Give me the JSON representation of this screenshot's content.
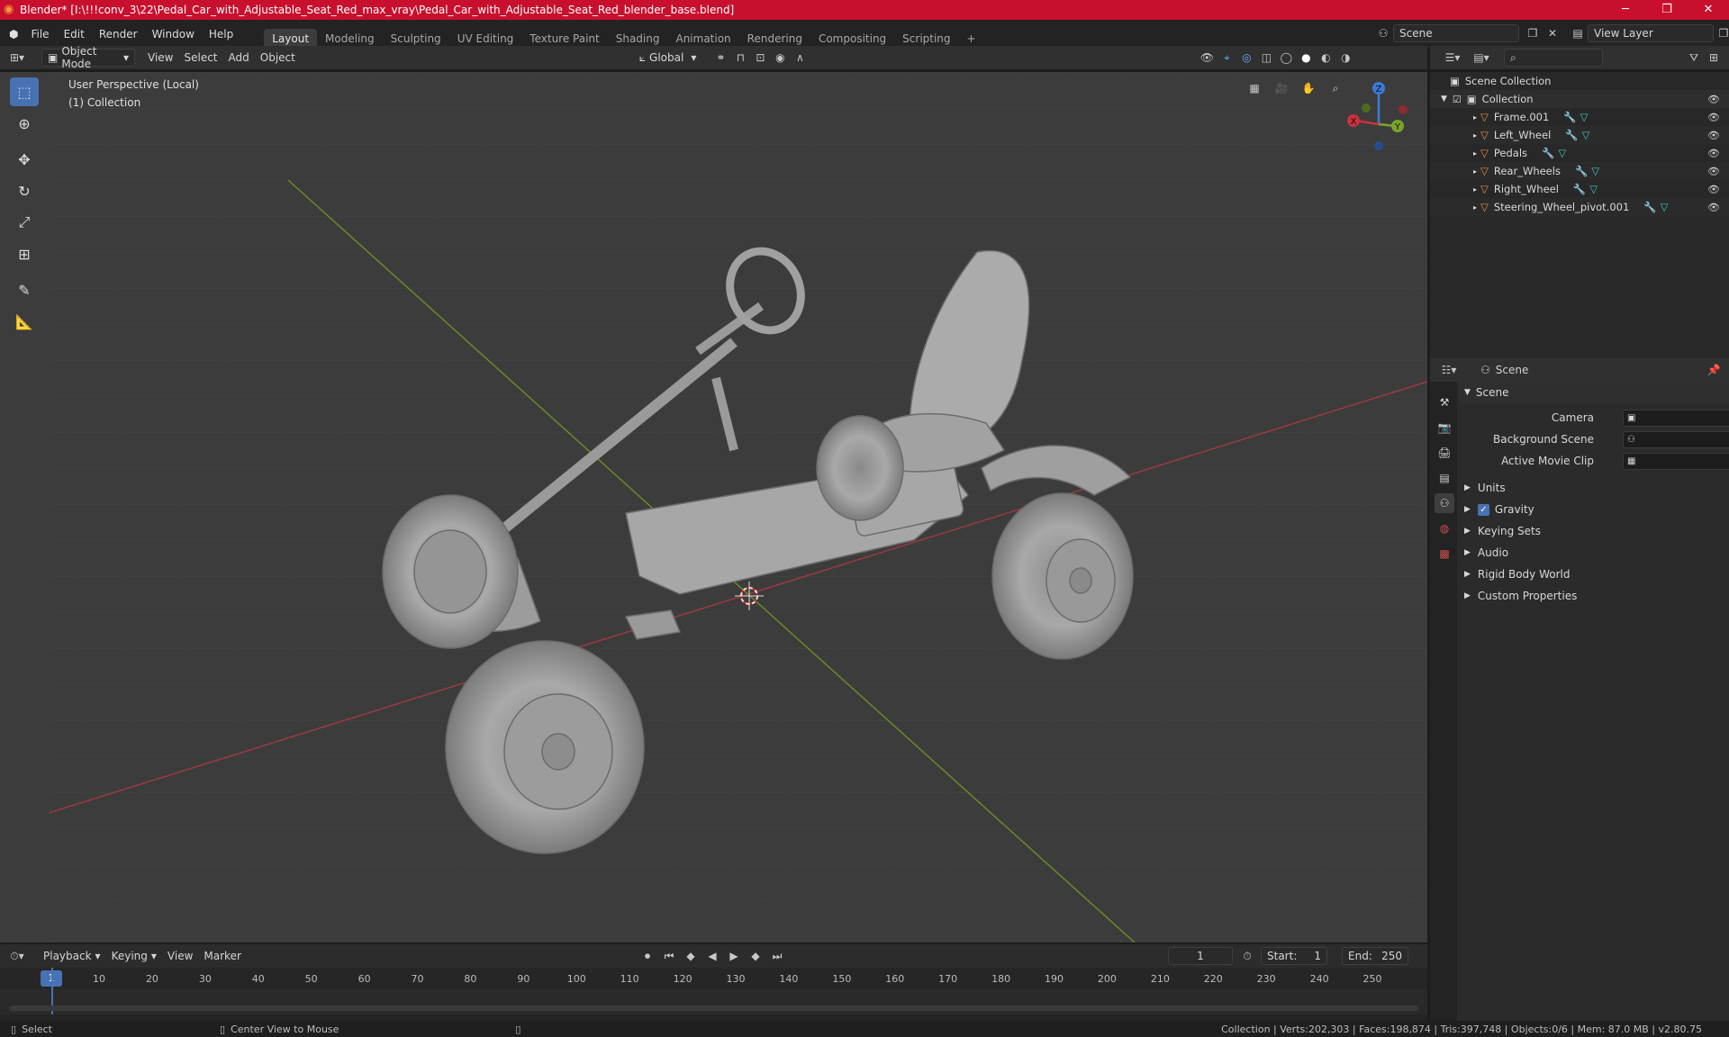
{
  "titlebar": {
    "title": "Blender* [I:\\!!!conv_3\\22\\Pedal_Car_with_Adjustable_Seat_Red_max_vray\\Pedal_Car_with_Adjustable_Seat_Red_blender_base.blend]",
    "minimize": "─",
    "maximize": "❐",
    "close": "✕"
  },
  "menu": {
    "items": [
      "File",
      "Edit",
      "Render",
      "Window",
      "Help"
    ]
  },
  "workspaces": [
    "Layout",
    "Modeling",
    "Sculpting",
    "UV Editing",
    "Texture Paint",
    "Shading",
    "Animation",
    "Rendering",
    "Compositing",
    "Scripting"
  ],
  "workspace_add": "+",
  "scene": {
    "label": "Scene",
    "view_layer": "View Layer"
  },
  "viewport_header": {
    "mode": "Object Mode",
    "menus": [
      "View",
      "Select",
      "Add",
      "Object"
    ],
    "orientation": "Global"
  },
  "viewport": {
    "perspective": "User Perspective (Local)",
    "collection": "(1) Collection",
    "gizmo": {
      "x": "X",
      "y": "Y",
      "z": "Z"
    }
  },
  "outliner": {
    "root": "Scene Collection",
    "collection": "Collection",
    "objects": [
      "Frame.001",
      "Left_Wheel",
      "Pedals",
      "Rear_Wheels",
      "Right_Wheel",
      "Steering_Wheel_pivot.001"
    ]
  },
  "properties": {
    "header": "Scene",
    "panel": "Scene",
    "fields": [
      {
        "label": "Camera"
      },
      {
        "label": "Background Scene"
      },
      {
        "label": "Active Movie Clip"
      }
    ],
    "sections": [
      "Units",
      "Gravity",
      "Keying Sets",
      "Audio",
      "Rigid Body World",
      "Custom Properties"
    ],
    "gravity_checked": true
  },
  "timeline": {
    "menus": [
      "Playback",
      "Keying",
      "View",
      "Marker"
    ],
    "current_frame": "1",
    "start_label": "Start:",
    "start": "1",
    "end_label": "End:",
    "end": "250",
    "ticks": [
      "1",
      "10",
      "20",
      "30",
      "40",
      "50",
      "60",
      "70",
      "80",
      "90",
      "100",
      "110",
      "120",
      "130",
      "140",
      "150",
      "160",
      "170",
      "180",
      "190",
      "200",
      "210",
      "220",
      "230",
      "240",
      "250"
    ]
  },
  "statusbar": {
    "left": "Select",
    "middle": "Center View to Mouse",
    "stats": "Collection | Verts:202,303 | Faces:198,874 | Tris:397,748 | Objects:0/6 | Mem: 87.0 MB | v2.80.75"
  },
  "colors": {
    "accent": "#4772b3",
    "titlebar": "#c8102e",
    "x_axis": "#c8323c",
    "y_axis": "#7ba428",
    "z_axis": "#3b7bd8"
  }
}
